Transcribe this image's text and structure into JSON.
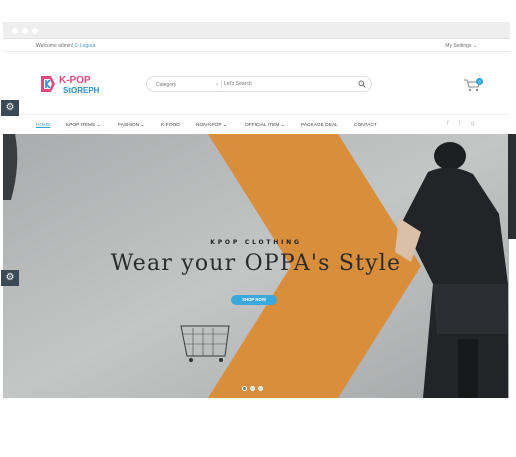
{
  "topbar": {
    "welcome_text": "Welcome admin!",
    "logout_label": "Logout",
    "settings_label": "My Settings"
  },
  "header": {
    "logo_line1": "K-POP",
    "logo_line2": "StOREPH",
    "search": {
      "category_label": "Category",
      "placeholder": "Let's Search"
    },
    "cart_count": "0"
  },
  "nav": {
    "items": [
      {
        "label": "HOME",
        "active": true
      },
      {
        "label": "KPOP ITEMS ⌄"
      },
      {
        "label": "FASHION ⌄"
      },
      {
        "label": "K-FOOD"
      },
      {
        "label": "NON-KPOP ⌄"
      },
      {
        "label": "OFFICIAL ITEM ⌄"
      },
      {
        "label": "PACKAGE DEAL"
      },
      {
        "label": "CONTACT"
      }
    ],
    "social": [
      "f",
      "t",
      "o"
    ]
  },
  "hero": {
    "subtitle": "KPOP CLOTHING",
    "title": "Wear your OPPA's Style",
    "button_label": "SHOP NOW",
    "slides": 3,
    "active_slide": 1
  },
  "colors": {
    "accent": "#3aa8dc",
    "logo_pink": "#e0497d",
    "logo_blue": "#2a8fd4",
    "hero_orange": "#d88e3a",
    "panel_dark": "#3a4a56"
  },
  "icons": [
    "gear-icon",
    "search-icon",
    "cart-icon",
    "facebook-icon",
    "twitter-icon",
    "instagram-icon"
  ]
}
